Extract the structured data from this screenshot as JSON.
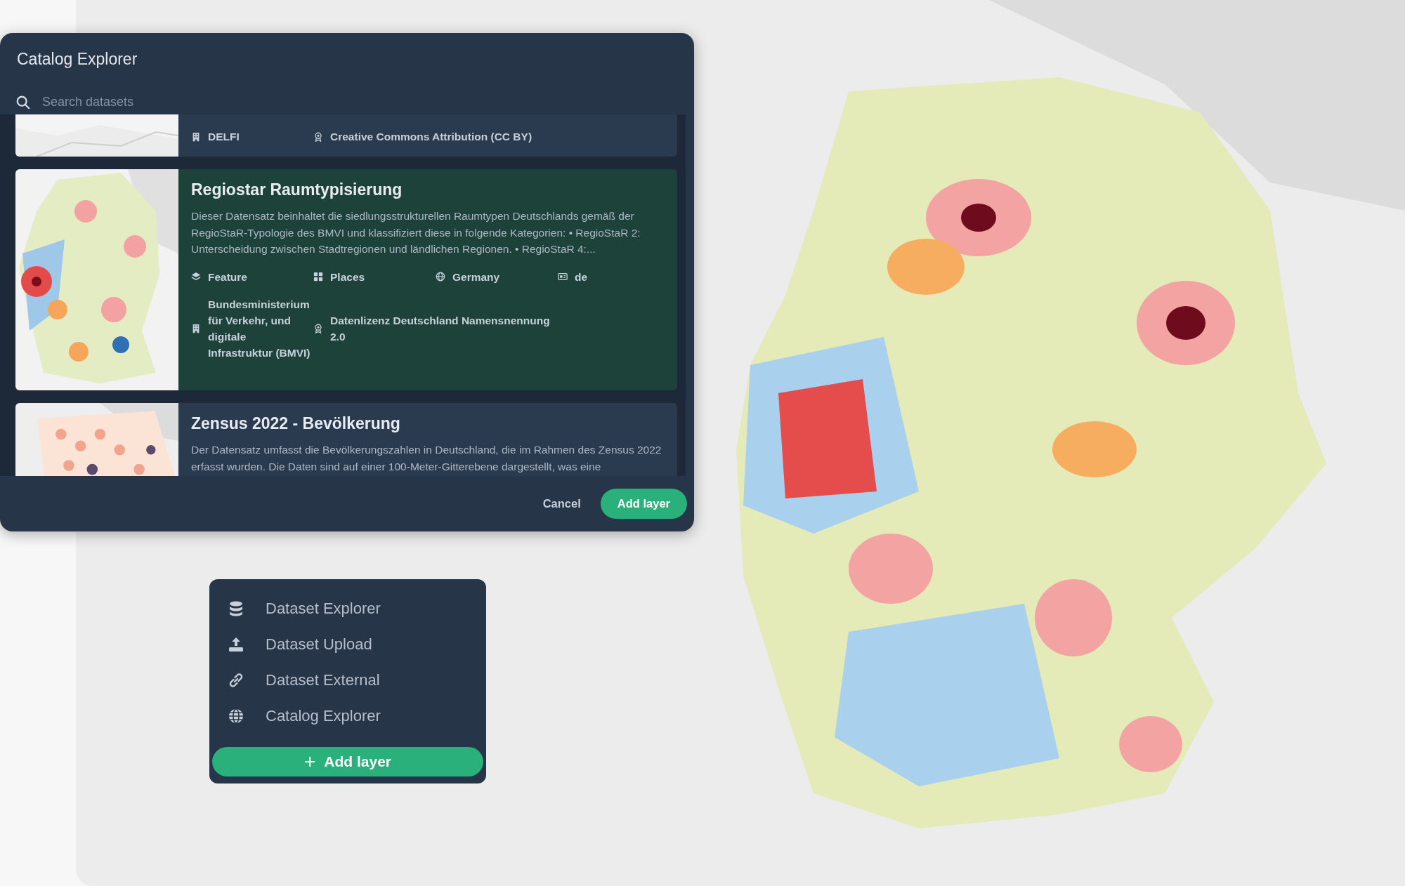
{
  "dialog": {
    "title": "Catalog Explorer",
    "search": {
      "placeholder": "Search datasets"
    },
    "datasets": [
      {
        "selected": false,
        "meta": [
          {
            "kind": "organization",
            "text": "DELFI"
          },
          {
            "kind": "license",
            "text": "Creative Commons Attribution (CC BY)"
          }
        ]
      },
      {
        "selected": true,
        "title": "Regiostar Raumtypisierung",
        "description": "Dieser Datensatz beinhaltet die siedlungsstrukturellen Raumtypen Deutschlands gemäß der RegioStaR-Typologie des BMVI und klassifiziert diese in folgende Kategorien: • RegioStaR 2: Unterscheidung zwischen Stadtregionen und ländlichen Regionen. • RegioStaR 4:...",
        "meta": [
          {
            "kind": "type",
            "text": "Feature"
          },
          {
            "kind": "category",
            "text": "Places"
          },
          {
            "kind": "region",
            "text": "Germany"
          },
          {
            "kind": "language",
            "text": "de"
          },
          {
            "kind": "organization",
            "text": "Bundesministerium für Verkehr, und digitale Infrastruktur (BMVI)"
          },
          {
            "kind": "license",
            "text": "Datenlizenz Deutschland Namensnennung 2.0"
          }
        ]
      },
      {
        "selected": false,
        "title": "Zensus 2022 - Bevölkerung",
        "description": "Der Datensatz umfasst die Bevölkerungszahlen in Deutschland, die im Rahmen des Zensus 2022 erfasst wurden. Die Daten sind auf einer 100-Meter-Gitterebene dargestellt, was eine"
      }
    ],
    "buttons": [
      {
        "kind": "text",
        "label": "Cancel"
      },
      {
        "kind": "primary",
        "label": "Add layer"
      }
    ]
  },
  "add_menu": {
    "items": [
      {
        "kind": "database",
        "label": "Dataset Explorer"
      },
      {
        "kind": "upload",
        "label": "Dataset Upload"
      },
      {
        "kind": "link",
        "label": "Dataset External"
      },
      {
        "kind": "globe",
        "label": "Catalog Explorer"
      }
    ],
    "button": {
      "icon": "+",
      "label": "Add layer"
    }
  }
}
